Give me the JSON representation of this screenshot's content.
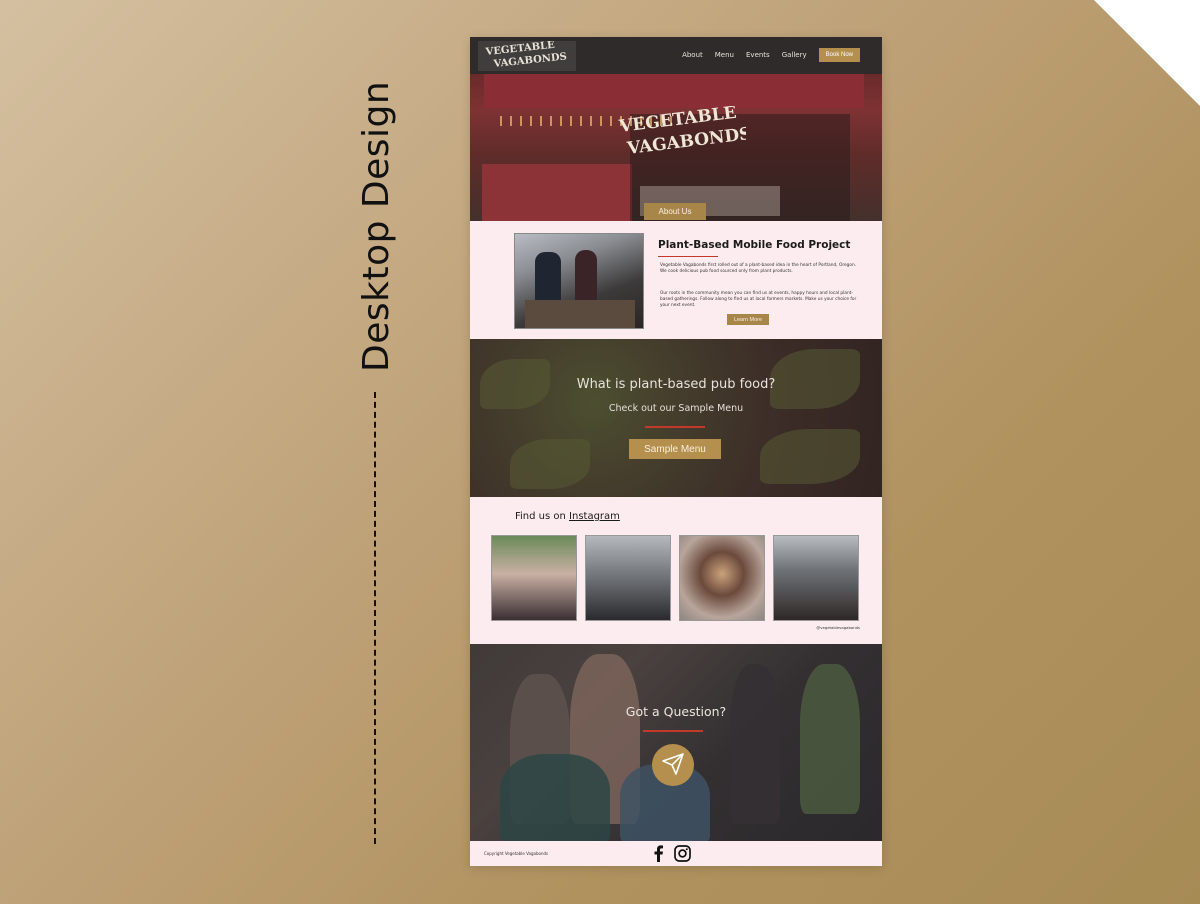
{
  "side_label": "Desktop Design",
  "nav": {
    "links": [
      "About",
      "Menu",
      "Events",
      "Gallery"
    ],
    "cta": "Book Now"
  },
  "hero": {
    "logo_line1": "VEGETABLE",
    "logo_line2": "VAGABONDS",
    "button": "About Us"
  },
  "about": {
    "title": "Plant-Based Mobile Food Project",
    "paragraph1": "Vegetable Vagabonds first rolled out of a plant-based idea in the heart of Portland, Oregon. We cook delicious pub food sourced only from plant products.",
    "paragraph2": "Our roots in the community mean you can find us at events, happy hours and local plant-based gatherings. Follow along to find us at local farmers markets. Make us your choice for your next event.",
    "button": "Learn More"
  },
  "menu_section": {
    "question": "What is plant-based pub food?",
    "subtitle": "Check out our Sample Menu",
    "button": "Sample Menu"
  },
  "instagram": {
    "prefix": "Find us on ",
    "link": "Instagram",
    "handle": "@vegetablevagabonds"
  },
  "contact": {
    "title": "Got a Question?",
    "icon": "send-icon"
  },
  "footer": {
    "copyright": "Copyright Vegetable Vagabonds",
    "icons": [
      "facebook-icon",
      "instagram-icon"
    ]
  },
  "colors": {
    "accent": "#b48f4d",
    "rule": "#c0392b",
    "section_bg": "#fcecef"
  }
}
